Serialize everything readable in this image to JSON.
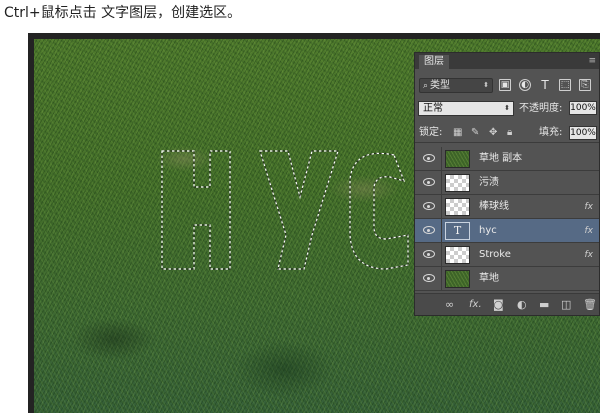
{
  "caption": "Ctrl+鼠标点击 文字图层，创建选区。",
  "panel": {
    "tab": "图层",
    "filter": {
      "kind_label": "类型",
      "buttons": [
        "image-filter-icon",
        "adjustment-filter-icon",
        "type-filter-icon",
        "shape-filter-icon",
        "smart-object-filter-icon"
      ]
    },
    "blend_mode": "正常",
    "opacity_label": "不透明度:",
    "opacity_value": "100%",
    "lock_label": "锁定:",
    "fill_label": "填充:",
    "fill_value": "100%",
    "layers": [
      {
        "name": "草地 副本",
        "thumb": "grass",
        "fx": ""
      },
      {
        "name": "污渍",
        "thumb": "transparent",
        "fx": ""
      },
      {
        "name": "棒球线",
        "thumb": "transparent",
        "fx": "fx"
      },
      {
        "name": "hyc",
        "thumb": "text",
        "thumb_glyph": "T",
        "fx": "fx",
        "selected": true
      },
      {
        "name": "Stroke",
        "thumb": "transparent",
        "fx": "fx"
      },
      {
        "name": "草地",
        "thumb": "grass",
        "fx": ""
      }
    ],
    "footer_icons": [
      "link-layers-icon",
      "fx-icon",
      "mask-icon",
      "adjustment-icon",
      "group-icon",
      "new-layer-icon",
      "trash-icon"
    ],
    "footer_fx_label": "fx."
  }
}
